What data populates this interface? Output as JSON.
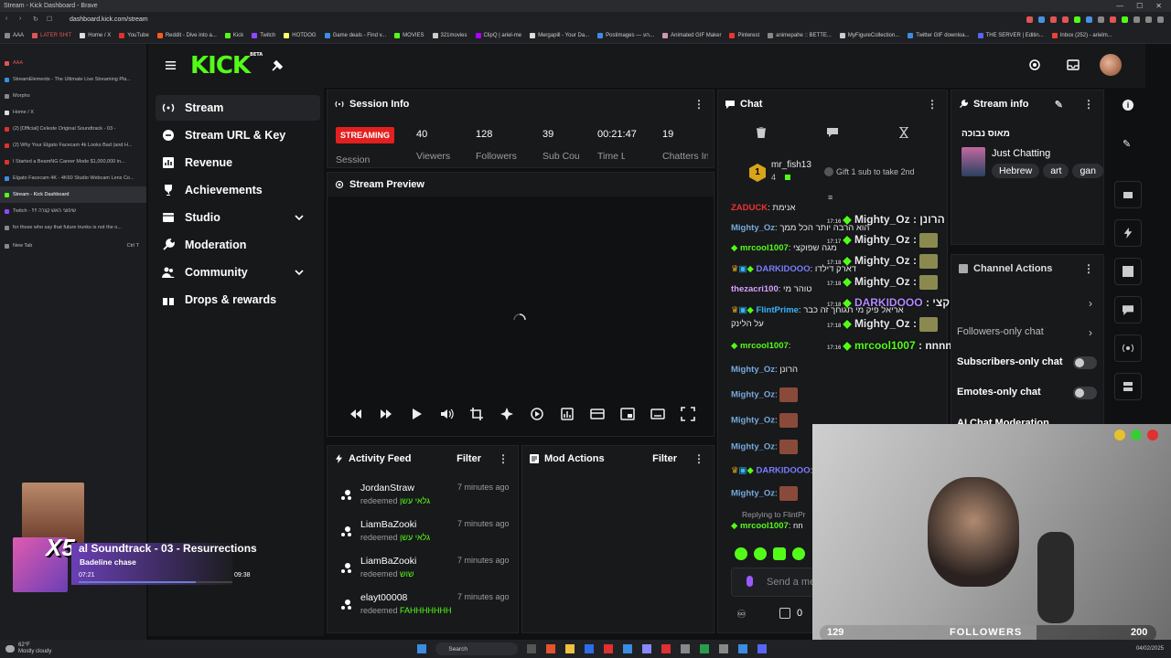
{
  "browser": {
    "window_title": "Stream - Kick Dashboard - Brave",
    "url": "dashboard.kick.com/stream",
    "bookmarks": [
      "AAA",
      "LATER SHIT",
      "Home / X",
      "YouTube",
      "Reddit - Dive into a...",
      "Kick",
      "Twitch",
      "HOTDOG",
      "Game deals - Find v...",
      "MOVIES",
      "321movies",
      "ClipQ | ariel-me",
      "Mergapill - Your Da...",
      "Postimages — הע...",
      "Animated GIF Maker",
      "Pinterest",
      "animepahe :: BETTE...",
      "MyFigureCollection...",
      "Twitter GIF downloa...",
      "THE SERVER | Editin...",
      "Inbox (252) - arielm..."
    ],
    "tabs": [
      "AAA",
      "StreamElements - The Ultimate Live Streaming Pla...",
      "Morpho",
      "Home / X",
      "(2) [Official] Celeste Original Soundtrack - 03 -",
      "(2) Why Your Elgato Facecam 4k Looks Bad (and H...",
      "I Started a BeamNG Career Mode $1,000,000 in...",
      "Elgato Facecam 4K - 4K60 Studio Webcam Lens Co...",
      "Stream - Kick Dashboard",
      "Twitch - !!!! שיפוצי האש קצרה",
      "for those who say that future trunks is not the o...",
      "New Tab"
    ],
    "new_tab_shortcut": "Ctrl T"
  },
  "kick": {
    "logo": "KICK",
    "logo_sup": "BETA"
  },
  "sidebar": {
    "items": [
      {
        "label": "Stream"
      },
      {
        "label": "Stream URL & Key"
      },
      {
        "label": "Revenue"
      },
      {
        "label": "Achievements"
      },
      {
        "label": "Studio"
      },
      {
        "label": "Moderation"
      },
      {
        "label": "Community"
      },
      {
        "label": "Drops & rewards"
      }
    ]
  },
  "session": {
    "title": "Session Info",
    "status": "STREAMING",
    "status_label": "Session",
    "stats": [
      {
        "value": "40",
        "label": "Viewers"
      },
      {
        "value": "128",
        "label": "Followers"
      },
      {
        "value": "39",
        "label": "Sub Counts"
      },
      {
        "value": "00:21:47",
        "label": "Time Live"
      },
      {
        "value": "19",
        "label": "Chatters In Avg"
      }
    ]
  },
  "preview": {
    "title": "Stream Preview"
  },
  "activity": {
    "title": "Activity Feed",
    "filter": "Filter",
    "items": [
      {
        "name": "JordanStraw",
        "ago": "7 minutes ago",
        "action": "redeemed",
        "reward": "גלאי עשן"
      },
      {
        "name": "LiamBaZooki",
        "ago": "7 minutes ago",
        "action": "redeemed",
        "reward": "גלאי עשן"
      },
      {
        "name": "LiamBaZooki",
        "ago": "7 minutes ago",
        "action": "redeemed",
        "reward": "שוש"
      },
      {
        "name": "elayt00008",
        "ago": "7 minutes ago",
        "action": "redeemed",
        "reward": "FAHHHHHHH"
      }
    ]
  },
  "modactions": {
    "title": "Mod Actions",
    "filter": "Filter"
  },
  "chat": {
    "title": "Chat",
    "top_gifter": {
      "name": "mr_fish13",
      "rank": "1",
      "count": "4"
    },
    "gift_prompt": "Gift 1 sub to take 2nd",
    "messages": [
      {
        "user": "ZADUCK",
        "text": "אנימת",
        "color": "#e33"
      },
      {
        "user": "Mighty_Oz",
        "text": "הוא הרבה יותר הכל ממך",
        "color": "#7ad"
      },
      {
        "user": "mrcool1007",
        "text": "מגה שפוקצי",
        "color": "#53fc18"
      },
      {
        "user": "DARKIDOOO",
        "text": "דארק דילדו",
        "color": "#7b7bff"
      },
      {
        "user": "thezacri100",
        "text": "טוהר מי",
        "color": "#d6a2ff"
      },
      {
        "user": "FlintPrime",
        "text": "אריאל פיק מי תגוחך זה כבר",
        "color": "#34b7ff"
      },
      {
        "user": "",
        "text": "על הלינק",
        "color": "#e7e8ea"
      },
      {
        "user": "mrcool1007",
        "text": "",
        "color": "#53fc18"
      },
      {
        "user": "Mighty_Oz",
        "text": "הרונן",
        "color": "#7ad"
      },
      {
        "user": "Mighty_Oz",
        "text": "",
        "color": "#7ad"
      },
      {
        "user": "Mighty_Oz",
        "text": "",
        "color": "#7ad"
      },
      {
        "user": "Mighty_Oz",
        "text": "",
        "color": "#7ad"
      },
      {
        "user": "DARKIDOOO",
        "text": "",
        "color": "#7b7bff"
      },
      {
        "user": "Mighty_Oz",
        "text": "",
        "color": "#7ad"
      }
    ],
    "reply_to": "Replying to FlintPr",
    "reply_user": "mrcool1007",
    "reply_text": "nn",
    "input_placeholder": "Send a me",
    "points": "0"
  },
  "overlay": {
    "lines": [
      {
        "time": "17:16",
        "user": "Mighty_Oz",
        "text": "הרונן"
      },
      {
        "time": "17:17",
        "user": "Mighty_Oz",
        "text": ""
      },
      {
        "time": "17:18",
        "user": "Mighty_Oz",
        "text": ""
      },
      {
        "time": "17:18",
        "user": "Mighty_Oz",
        "text": ""
      },
      {
        "time": "17:18",
        "user": "DARKIDOOO",
        "text": "ספר שפוקצי"
      },
      {
        "time": "17:18",
        "user": "Mighty_Oz",
        "text": ""
      },
      {
        "time": "17:16",
        "user": "mrcool1007",
        "text": "nnnnnnnnn"
      }
    ]
  },
  "streaminfo": {
    "title": "Stream info",
    "stream_title": "מאוס נבוכה",
    "category": "Just Chatting",
    "tags": [
      "Hebrew",
      "art",
      "gan"
    ]
  },
  "channel": {
    "title": "Channel Actions",
    "rows": [
      {
        "label": "Followers-only chat"
      },
      {
        "label": "Subscribers-only chat"
      },
      {
        "label": "Emotes-only chat"
      },
      {
        "label": "AI Chat Moderation"
      }
    ]
  },
  "nowplaying": {
    "multiplier": "X5",
    "track": "al Soundtrack - 03 - Resurrections",
    "subtitle": "Badeline chase",
    "elapsed": "07:21",
    "total": "09:38",
    "progress": 0.76
  },
  "followers_goal": {
    "current": "129",
    "label": "FOLLOWERS",
    "target": "200",
    "progress": 0.645
  },
  "taskbar": {
    "weather_temp": "62°F",
    "weather_desc": "Mostly cloudy",
    "search": "Search",
    "date": "04/02/2025"
  },
  "colors": {
    "accent": "#53fc18",
    "live": "#e32020"
  }
}
